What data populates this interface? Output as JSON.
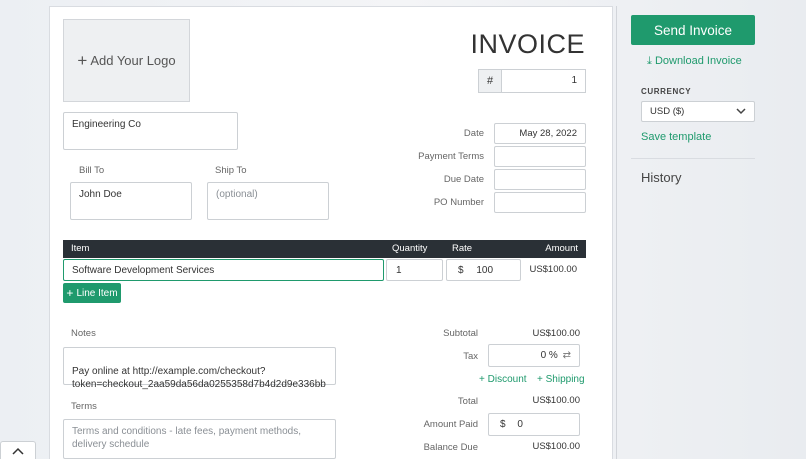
{
  "invoice": {
    "logo_label": "Add Your Logo",
    "title": "INVOICE",
    "number_prefix": "#",
    "number": "1",
    "from": "Engineering Co",
    "bill_to_label": "Bill To",
    "bill_to": "John Doe",
    "ship_to_label": "Ship To",
    "ship_to_placeholder": "(optional)",
    "meta": {
      "date_label": "Date",
      "date": "May 28, 2022",
      "payment_terms_label": "Payment Terms",
      "payment_terms": "",
      "due_date_label": "Due Date",
      "due_date": "",
      "po_label": "PO Number",
      "po": ""
    },
    "table": {
      "headers": [
        "Item",
        "Quantity",
        "Rate",
        "Amount"
      ],
      "rows": [
        {
          "item": "Software Development Services",
          "quantity": "1",
          "rate_currency": "$",
          "rate": "100",
          "amount": "US$100.00"
        }
      ],
      "add_line_label": "Line Item"
    },
    "notes_label": "Notes",
    "notes": "Pay online at http://example.com/checkout?\ntoken=checkout_2aa59da56da0255358d7b4d2d9e336bb",
    "terms_label": "Terms",
    "terms_placeholder": "Terms and conditions - late fees, payment methods, delivery schedule",
    "totals": {
      "subtotal_label": "Subtotal",
      "subtotal": "US$100.00",
      "tax_label": "Tax",
      "tax": "0",
      "tax_unit": "%",
      "discount_label": "Discount",
      "shipping_label": "Shipping",
      "total_label": "Total",
      "total": "US$100.00",
      "paid_label": "Amount Paid",
      "paid_currency": "$",
      "paid": "0",
      "balance_label": "Balance Due",
      "balance": "US$100.00"
    }
  },
  "sidebar": {
    "send_label": "Send Invoice",
    "download_label": "Download Invoice",
    "currency_label": "CURRENCY",
    "currency_value": "USD ($)",
    "save_template_label": "Save template",
    "history_label": "History"
  },
  "colors": {
    "accent": "#1f9a6d",
    "table_header": "#2a3036"
  }
}
